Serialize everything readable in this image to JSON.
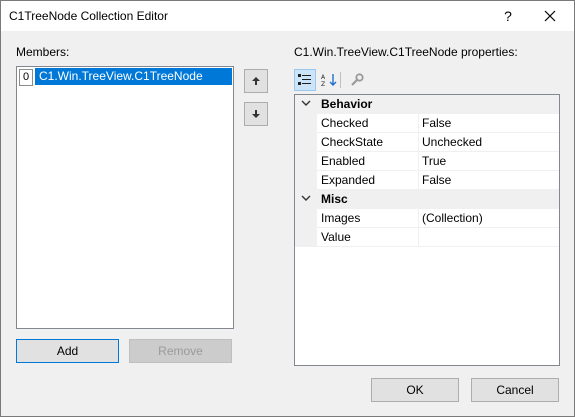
{
  "window": {
    "title": "C1TreeNode Collection Editor",
    "help": "?"
  },
  "members": {
    "label": "Members:",
    "items": [
      {
        "index": "0",
        "text": "C1.Win.TreeView.C1TreeNode"
      }
    ],
    "add_label": "Add",
    "remove_label": "Remove"
  },
  "properties": {
    "label": "C1.Win.TreeView.C1TreeNode properties:",
    "categories": [
      {
        "name": "Behavior",
        "rows": [
          {
            "name": "Checked",
            "value": "False"
          },
          {
            "name": "CheckState",
            "value": "Unchecked"
          },
          {
            "name": "Enabled",
            "value": "True"
          },
          {
            "name": "Expanded",
            "value": "False"
          }
        ]
      },
      {
        "name": "Misc",
        "rows": [
          {
            "name": "Images",
            "value": "(Collection)"
          },
          {
            "name": "Value",
            "value": ""
          }
        ]
      }
    ]
  },
  "footer": {
    "ok_label": "OK",
    "cancel_label": "Cancel"
  },
  "colors": {
    "selection": "#0078d7",
    "dialog_bg": "#f0f0f0"
  },
  "icons": {
    "up": "arrow-up-icon",
    "down": "arrow-down-icon",
    "categorized": "categorized-icon",
    "alphabetical": "alphabetical-icon",
    "property_pages": "wrench-icon",
    "close": "close-icon"
  }
}
